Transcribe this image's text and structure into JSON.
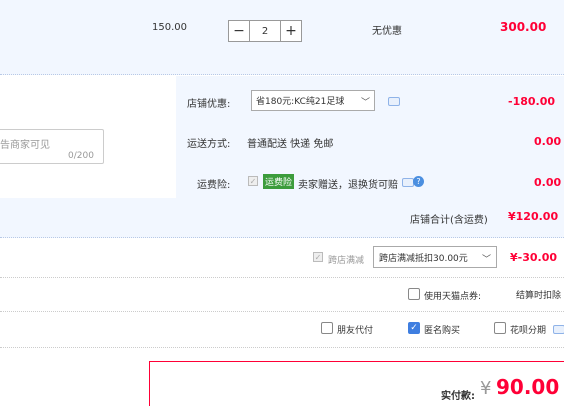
{
  "item": {
    "unit_price": "150.00",
    "quantity": "2",
    "minus": "−",
    "plus": "+",
    "discount_text": "无优惠",
    "subtotal": "300.00"
  },
  "message": {
    "placeholder": "告商家可见",
    "counter": "0/200"
  },
  "shop": {
    "coupon_label": "店铺优惠:",
    "coupon_select": "省180元:KC纯21足球",
    "coupon_amount": "-180.00",
    "shipping_label": "运送方式:",
    "shipping_text": "普通配送 快递 免邮",
    "shipping_amount": "0.00",
    "insurance_label": "运费险:",
    "insurance_tag": "运费险",
    "insurance_text": "卖家赠送，退换货可赔",
    "insurance_amount": "0.00",
    "total_label": "店铺合计(含运费)",
    "total_amount": "¥120.00"
  },
  "cross_store": {
    "label": "跨店满减",
    "select": "跨店满减抵扣30.00元",
    "amount": "¥-30.00"
  },
  "points": {
    "label": "使用天猫点券:",
    "right_text": "结算时扣除"
  },
  "options": {
    "friend_pay": "朋友代付",
    "anonymous": "匿名购买",
    "installment": "花呗分期"
  },
  "pay": {
    "label": "实付款:",
    "currency": "¥",
    "amount": "90.00"
  },
  "colors": {
    "accent_red": "#ff0036",
    "section_bg": "#f2f7ff",
    "checkbox_blue": "#3f7ee0"
  }
}
